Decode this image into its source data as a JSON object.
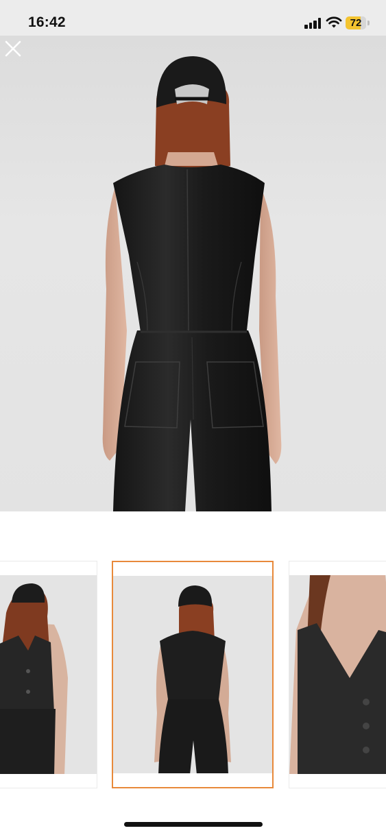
{
  "status_bar": {
    "time": "16:42",
    "battery_level": "72",
    "icons": [
      "signal-icon",
      "wifi-icon",
      "battery-icon"
    ]
  },
  "viewer": {
    "close_icon": "close-icon",
    "main_image": "product-back-view",
    "selected_thumbnail_index": 1
  },
  "thumbnails": [
    {
      "image": "product-front-view-cap"
    },
    {
      "image": "product-back-view"
    },
    {
      "image": "product-front-closeup"
    }
  ],
  "colors": {
    "accent_border": "#e8893a",
    "battery_fill": "#f4c430"
  }
}
